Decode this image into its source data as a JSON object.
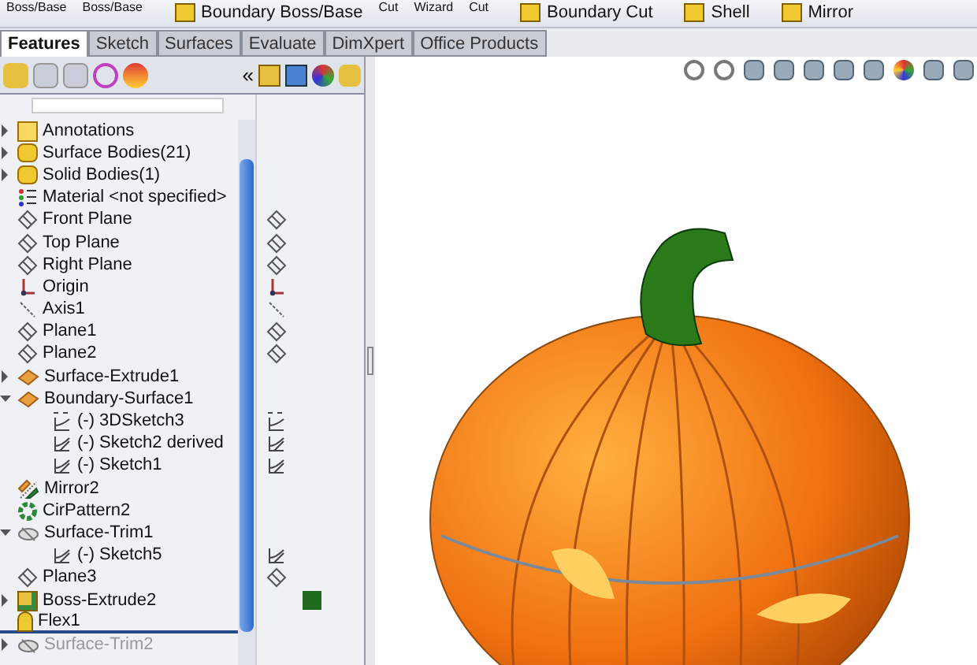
{
  "ribbon": {
    "items": [
      {
        "label": "Boss/Base",
        "icon": false
      },
      {
        "label": "Boss/Base",
        "icon": false
      },
      {
        "label": "Boundary Boss/Base",
        "icon": true
      },
      {
        "label": "Cut",
        "icon": false
      },
      {
        "label": "Wizard",
        "icon": false
      },
      {
        "label": "Cut",
        "icon": false
      },
      {
        "label": "Boundary Cut",
        "icon": true
      },
      {
        "label": "Shell",
        "icon": true
      },
      {
        "label": "Mirror",
        "icon": true
      }
    ]
  },
  "tabs": [
    {
      "label": "Features",
      "selected": true
    },
    {
      "label": "Sketch",
      "selected": false
    },
    {
      "label": "Surfaces",
      "selected": false
    },
    {
      "label": "Evaluate",
      "selected": false
    },
    {
      "label": "DimXpert",
      "selected": false
    },
    {
      "label": "Office Products",
      "selected": false
    }
  ],
  "panel": {
    "collapse_glyph": "«"
  },
  "tree": [
    {
      "label": "Annotations",
      "kind": "annotations",
      "expanded": false,
      "disabled": false
    },
    {
      "label": "Surface Bodies(21)",
      "kind": "bodies",
      "expanded": false,
      "disabled": false
    },
    {
      "label": "Solid Bodies(1)",
      "kind": "bodies",
      "expanded": false,
      "disabled": false
    },
    {
      "label": "Material <not specified>",
      "kind": "material",
      "disabled": false
    },
    {
      "label": "Front Plane",
      "kind": "plane",
      "disabled": false
    },
    {
      "label": "Top Plane",
      "kind": "plane",
      "disabled": false
    },
    {
      "label": "Right Plane",
      "kind": "plane",
      "disabled": false
    },
    {
      "label": "Origin",
      "kind": "origin",
      "disabled": false
    },
    {
      "label": "Axis1",
      "kind": "axis",
      "disabled": false
    },
    {
      "label": "Plane1",
      "kind": "plane",
      "disabled": false
    },
    {
      "label": "Plane2",
      "kind": "plane",
      "disabled": false
    },
    {
      "label": "Surface-Extrude1",
      "kind": "feature",
      "expanded": false,
      "disabled": false
    },
    {
      "label": "Boundary-Surface1",
      "kind": "feature",
      "expanded": true,
      "disabled": false,
      "children": [
        {
          "label": "(-) 3DSketch3",
          "kind": "sketch3d",
          "disabled": false
        },
        {
          "label": "(-) Sketch2 derived",
          "kind": "sketch",
          "disabled": false
        },
        {
          "label": "(-) Sketch1",
          "kind": "sketch",
          "disabled": false
        }
      ]
    },
    {
      "label": "Mirror2",
      "kind": "mirror",
      "disabled": false
    },
    {
      "label": "CirPattern2",
      "kind": "pattern",
      "disabled": false
    },
    {
      "label": "Surface-Trim1",
      "kind": "trim",
      "expanded": true,
      "disabled": false,
      "children": [
        {
          "label": "(-) Sketch5",
          "kind": "sketch",
          "disabled": false
        }
      ]
    },
    {
      "label": "Plane3",
      "kind": "plane",
      "disabled": false
    },
    {
      "label": "Boss-Extrude2",
      "kind": "boss",
      "expanded": false,
      "disabled": false,
      "color": "#1e6a1e"
    },
    {
      "label": "Flex1",
      "kind": "flex",
      "disabled": false
    },
    {
      "label": "Surface-Trim2",
      "kind": "trim",
      "expanded": false,
      "disabled": true
    }
  ]
}
